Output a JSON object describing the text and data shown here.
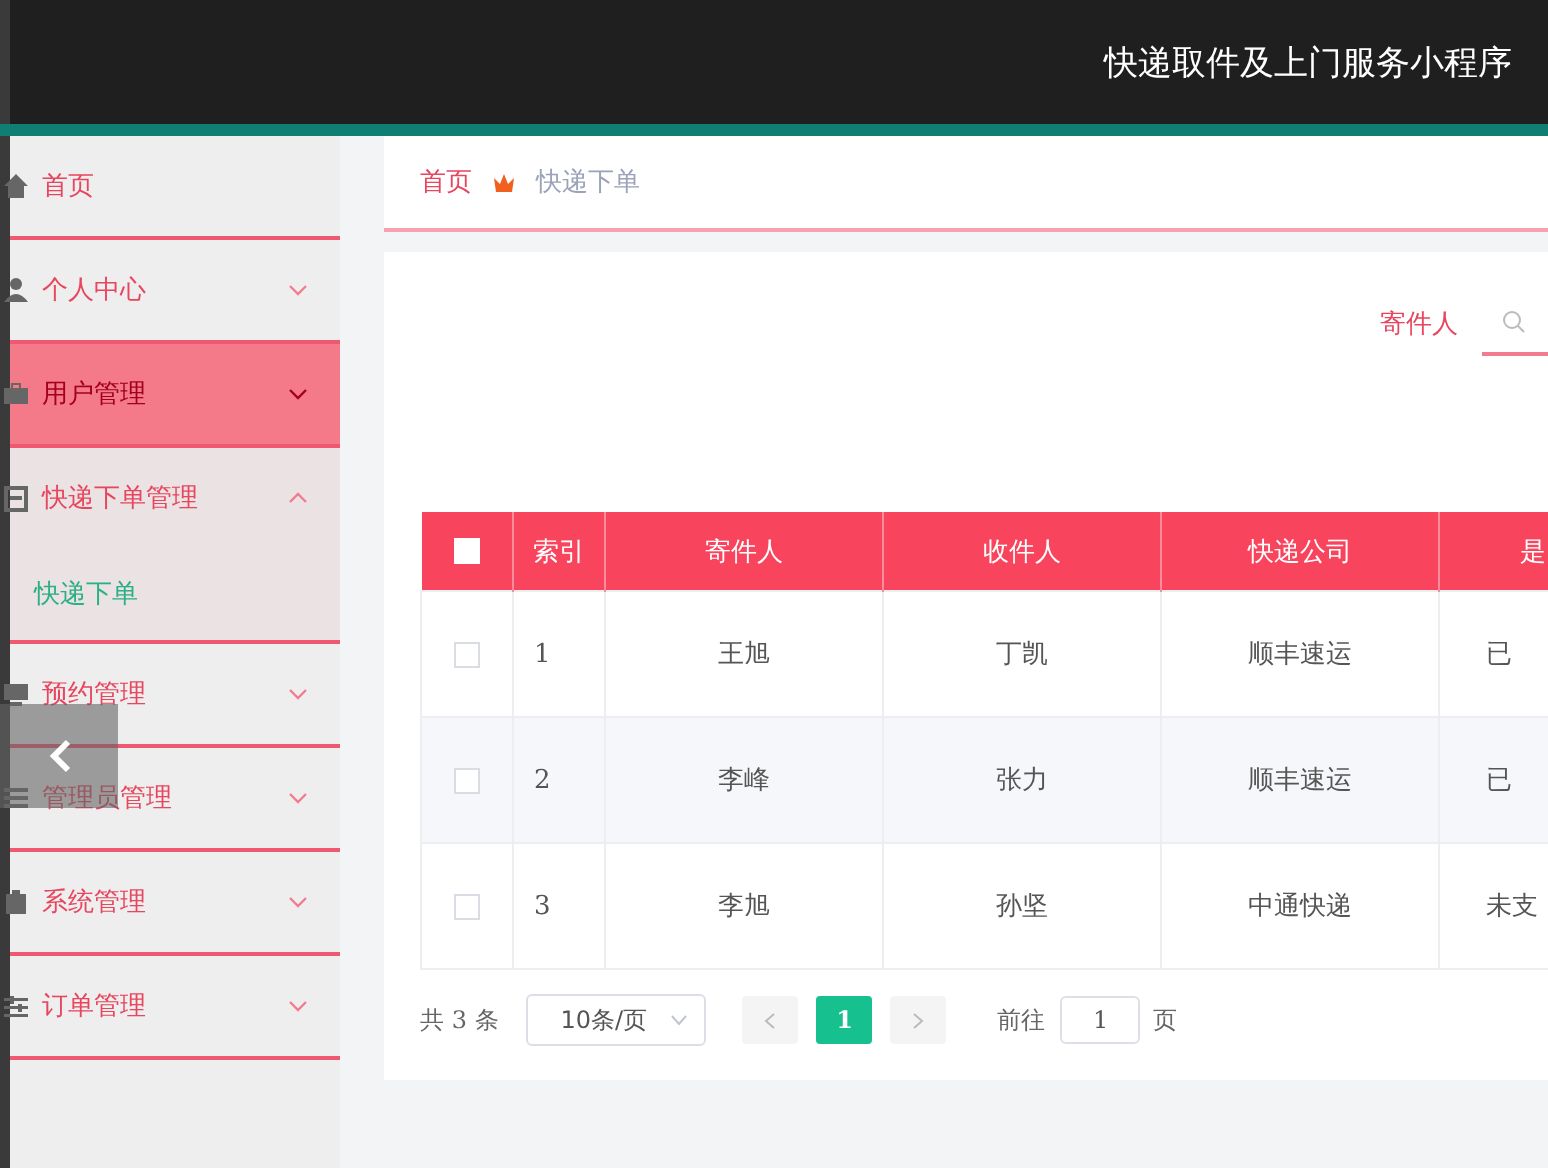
{
  "header": {
    "title": "快递取件及上门服务小程序"
  },
  "sidebar": {
    "items": [
      {
        "label": "首页",
        "selected": false,
        "expanded": false,
        "has_children": false
      },
      {
        "label": "个人中心",
        "selected": false,
        "expanded": false,
        "has_children": true
      },
      {
        "label": "用户管理",
        "selected": true,
        "expanded": false,
        "has_children": true
      },
      {
        "label": "快递下单管理",
        "selected": false,
        "expanded": true,
        "has_children": true,
        "children": [
          {
            "label": "快递下单"
          }
        ]
      },
      {
        "label": "预约管理",
        "selected": false,
        "expanded": false,
        "has_children": true
      },
      {
        "label": "管理员管理",
        "selected": false,
        "expanded": false,
        "has_children": true
      },
      {
        "label": "系统管理",
        "selected": false,
        "expanded": false,
        "has_children": true
      },
      {
        "label": "订单管理",
        "selected": false,
        "expanded": false,
        "has_children": true
      }
    ]
  },
  "breadcrumb": [
    "首页",
    "快递下单"
  ],
  "search": {
    "label": "寄件人"
  },
  "table": {
    "all_checked": false,
    "columns": [
      "索引",
      "寄件人",
      "收件人",
      "快递公司",
      "是"
    ],
    "rows": [
      {
        "checked": false,
        "cells": [
          "1",
          "王旭",
          "丁凯",
          "顺丰速运",
          "已"
        ]
      },
      {
        "checked": false,
        "cells": [
          "2",
          "李峰",
          "张力",
          "顺丰速运",
          "已"
        ]
      },
      {
        "checked": false,
        "cells": [
          "3",
          "李旭",
          "孙坚",
          "中通快递",
          "未支"
        ]
      }
    ]
  },
  "pagination": {
    "total": "共 3 条",
    "page_size": "10条/页",
    "pages": [
      {
        "label": "1",
        "selected": true
      }
    ],
    "goto_label": "前往",
    "goto_value": "1",
    "page_unit": "页"
  }
}
